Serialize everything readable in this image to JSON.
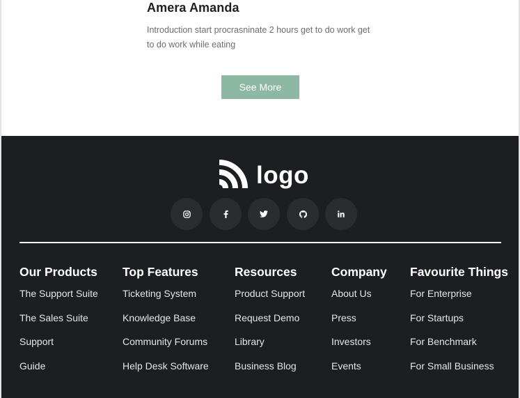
{
  "testimonial": {
    "name": "Amera Amanda",
    "text": "Introduction start procrasninate 2 hours get to do work get to do work while eating",
    "button_label": "See More"
  },
  "footer": {
    "logo_text": "logo",
    "socials": [
      "instagram-icon",
      "facebook-icon",
      "twitter-icon",
      "github-icon",
      "linkedin-icon"
    ],
    "columns": [
      {
        "title": "Our Products",
        "links": [
          "The Support Suite",
          "The Sales Suite",
          "Support",
          "Guide"
        ]
      },
      {
        "title": "Top Features",
        "links": [
          "Ticketing System",
          "Knowledge Base",
          "Community Forums",
          "Help Desk Software"
        ]
      },
      {
        "title": "Resources",
        "links": [
          "Product Support",
          "Request Demo",
          "Library",
          "Business Blog"
        ]
      },
      {
        "title": "Company",
        "links": [
          "About Us",
          "Press",
          "Investors",
          "Events"
        ]
      },
      {
        "title": "Favourite Things",
        "links": [
          "For Enterprise",
          "For Startups",
          "For Benchmark",
          "For Small Business"
        ]
      }
    ]
  },
  "colors": {
    "accent": "#8db8a4",
    "footer_bg": "#1d1e21",
    "social_bg": "#2a2c30"
  }
}
